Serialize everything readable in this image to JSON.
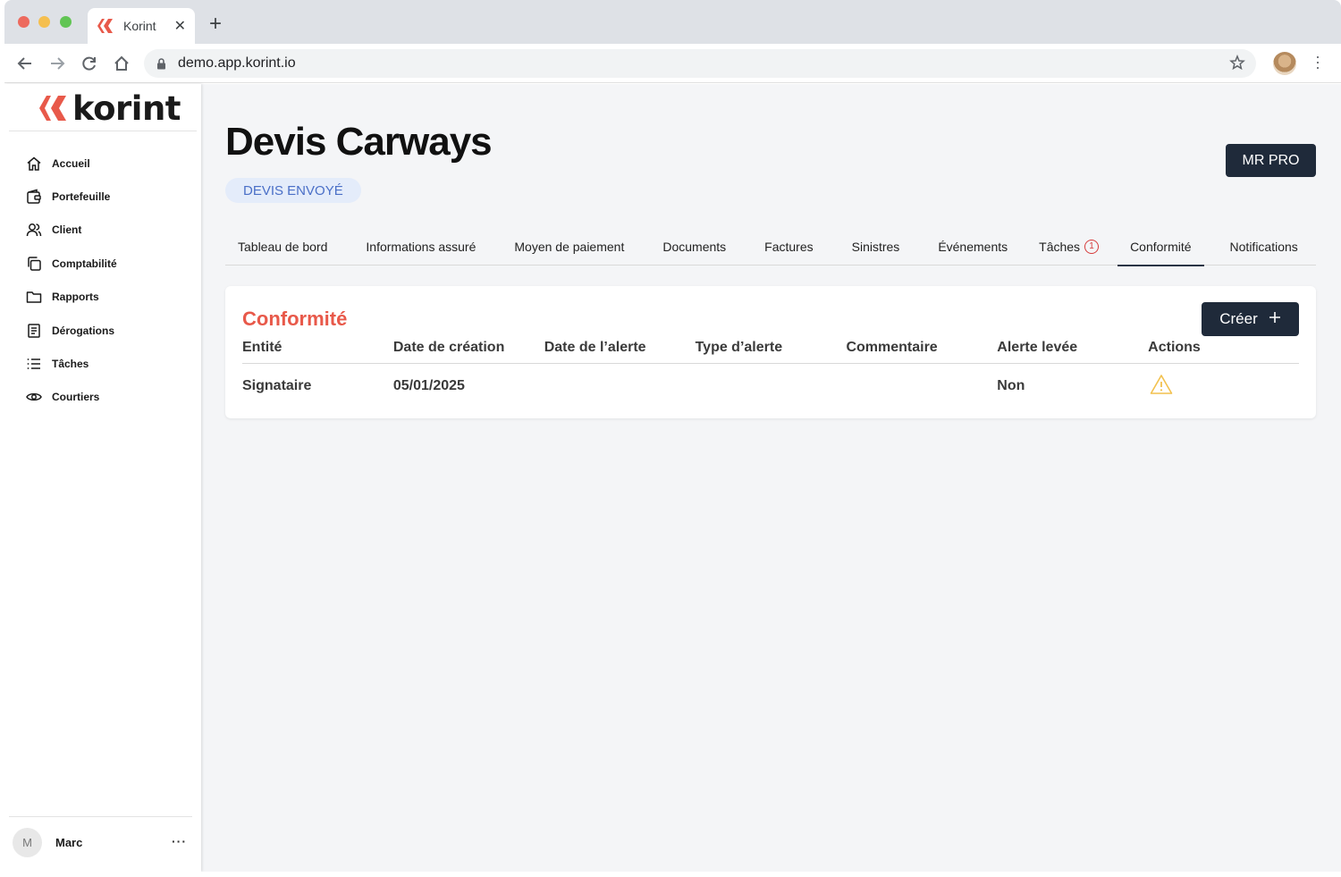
{
  "browser": {
    "tab_title": "Korint",
    "url": "demo.app.korint.io"
  },
  "brand": {
    "name": "korint",
    "accent": "#e8594a",
    "dark": "#1f2a3a"
  },
  "sidebar": {
    "items": [
      {
        "label": "Accueil",
        "icon": "home-icon"
      },
      {
        "label": "Portefeuille",
        "icon": "wallet-icon"
      },
      {
        "label": "Client",
        "icon": "users-icon"
      },
      {
        "label": "Comptabilité",
        "icon": "copy-icon"
      },
      {
        "label": "Rapports",
        "icon": "folder-icon"
      },
      {
        "label": "Dérogations",
        "icon": "document-icon"
      },
      {
        "label": "Tâches",
        "icon": "list-icon"
      },
      {
        "label": "Courtiers",
        "icon": "eye-icon"
      }
    ],
    "user": {
      "initial": "M",
      "name": "Marc",
      "more": "···"
    }
  },
  "header": {
    "title": "Devis Carways",
    "status": "DEVIS ENVOYÉ",
    "product_button": "MR PRO"
  },
  "tabs": [
    {
      "label": "Tableau de bord"
    },
    {
      "label": "Informations assuré"
    },
    {
      "label": "Moyen de paiement"
    },
    {
      "label": "Documents"
    },
    {
      "label": "Factures"
    },
    {
      "label": "Sinistres"
    },
    {
      "label": "Événements"
    },
    {
      "label": "Tâches",
      "count": "1"
    },
    {
      "label": "Conformité",
      "active": true
    },
    {
      "label": "Notifications"
    }
  ],
  "compliance": {
    "title": "Conformité",
    "create_label": "Créer",
    "columns": [
      "Entité",
      "Date de création",
      "Date de l’alerte",
      "Type d’alerte",
      "Commentaire",
      "Alerte levée",
      "Actions"
    ],
    "rows": [
      {
        "entite": "Signataire",
        "date_creation": "05/01/2025",
        "date_alerte": "",
        "type_alerte": "",
        "commentaire": "",
        "alerte_levee": "Non",
        "action_icon": "warning-icon"
      }
    ]
  }
}
